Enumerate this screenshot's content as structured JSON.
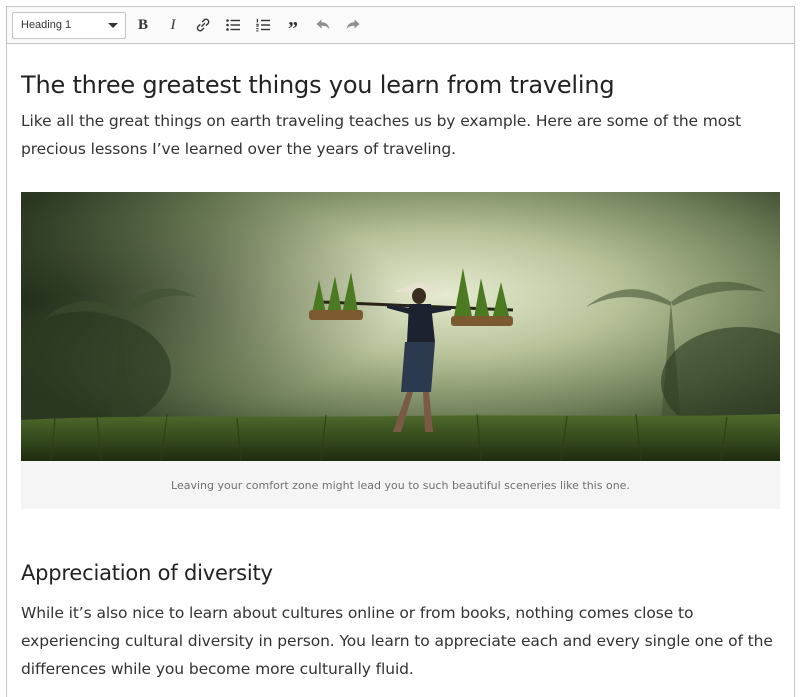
{
  "toolbar": {
    "heading_select": "Heading 1",
    "buttons": [
      {
        "name": "bold",
        "icon": "bold-icon"
      },
      {
        "name": "italic",
        "icon": "italic-icon"
      },
      {
        "name": "link",
        "icon": "link-icon"
      },
      {
        "name": "bulleted-list",
        "icon": "bulleted-list-icon"
      },
      {
        "name": "numbered-list",
        "icon": "numbered-list-icon"
      },
      {
        "name": "block-quote",
        "icon": "quote-icon"
      },
      {
        "name": "undo",
        "icon": "undo-icon"
      },
      {
        "name": "redo",
        "icon": "redo-icon"
      }
    ],
    "bold_glyph": "B",
    "italic_glyph": "I",
    "quote_glyph": "”"
  },
  "document": {
    "title": "The three greatest things you learn from traveling",
    "intro": "Like all the great things on earth traveling teaches us by example. Here are some of the most precious lessons I’ve learned over the years of traveling.",
    "figure": {
      "image": "rice-farmer-carrying-seedlings-in-misty-field",
      "caption": "Leaving your comfort zone might lead you to such beautiful sceneries like this one."
    },
    "section": {
      "heading": "Appreciation of diversity",
      "text": "While it’s also nice to learn about cultures online or from books, nothing comes close to experiencing cultural diversity in person. You learn to appreciate each and every single one of the differences while you become more culturally fluid."
    }
  },
  "colors": {
    "toolbar_bg": "#fafafa",
    "border": "#c4c4c4",
    "text": "#333333",
    "caption_bg": "#f5f5f5"
  }
}
